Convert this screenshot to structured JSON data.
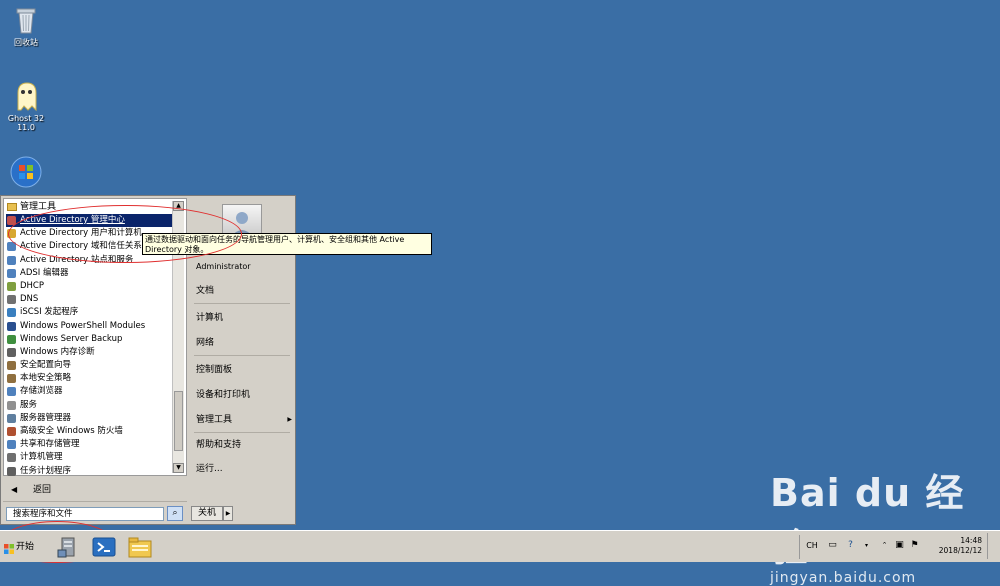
{
  "desktop": {
    "icons": [
      {
        "label": "回收站",
        "icon": "recycle-bin-icon"
      },
      {
        "label": "Ghost 32 11.0",
        "icon": "ghost-icon"
      },
      {
        "label": "",
        "icon": "windows-orb-icon"
      }
    ]
  },
  "start_menu": {
    "folder_label": "管理工具",
    "programs": [
      {
        "label": "Active Directory 管理中心",
        "selected": true,
        "color": "#c0504d"
      },
      {
        "label": "Active Directory 用户和计算机",
        "selected": false,
        "color": "#d8a830"
      },
      {
        "label": "Active Directory 域和信任关系",
        "selected": false,
        "color": "#4f81bd"
      },
      {
        "label": "Active Directory 站点和服务",
        "selected": false,
        "color": "#4f81bd"
      },
      {
        "label": "ADSI 编辑器",
        "selected": false,
        "color": "#4f81bd"
      },
      {
        "label": "DHCP",
        "selected": false,
        "color": "#7f9f3f"
      },
      {
        "label": "DNS",
        "selected": false,
        "color": "#707070"
      },
      {
        "label": "iSCSI 发起程序",
        "selected": false,
        "color": "#3a7fbf"
      },
      {
        "label": "Windows PowerShell Modules",
        "selected": false,
        "color": "#2a4f8f"
      },
      {
        "label": "Windows Server Backup",
        "selected": false,
        "color": "#3f8f3f"
      },
      {
        "label": "Windows 内存诊断",
        "selected": false,
        "color": "#606060"
      },
      {
        "label": "安全配置向导",
        "selected": false,
        "color": "#8f6f3f"
      },
      {
        "label": "本地安全策略",
        "selected": false,
        "color": "#8f6f3f"
      },
      {
        "label": "存储浏览器",
        "selected": false,
        "color": "#4f81bd"
      },
      {
        "label": "服务",
        "selected": false,
        "color": "#909090"
      },
      {
        "label": "服务器管理器",
        "selected": false,
        "color": "#5f7f9f"
      },
      {
        "label": "高级安全 Windows 防火墙",
        "selected": false,
        "color": "#b05030"
      },
      {
        "label": "共享和存储管理",
        "selected": false,
        "color": "#4f81bd"
      },
      {
        "label": "计算机管理",
        "selected": false,
        "color": "#6f6f6f"
      },
      {
        "label": "任务计划程序",
        "selected": false,
        "color": "#606060"
      }
    ],
    "back_label": "返回",
    "search_placeholder": "搜索程序和文件",
    "right_items": [
      {
        "label": "Administrator"
      },
      {
        "label": "文档"
      },
      {
        "label": "计算机"
      },
      {
        "label": "网络"
      },
      {
        "label": "控制面板"
      },
      {
        "label": "设备和打印机"
      },
      {
        "label": "管理工具",
        "arrow": "▶"
      },
      {
        "label": "帮助和支持"
      },
      {
        "label": "运行..."
      }
    ],
    "shutdown_label": "关机",
    "shutdown_arrow": "▶"
  },
  "tooltip": {
    "text": "通过数据驱动和面向任务的导航管理用户、计算机、安全组和其他 Active Directory 对象。"
  },
  "taskbar": {
    "start_label": "开始",
    "apps": [
      "server-manager-icon",
      "powershell-icon",
      "explorer-folder-icon"
    ],
    "tray": {
      "lang": "CH",
      "clock_time": "14:48",
      "clock_date": "2018/12/12"
    }
  },
  "watermark": {
    "logo": "Bai du 经验",
    "url": "jingyan.baidu.com"
  },
  "colors": {
    "desktop": "#3a6ea5",
    "selection": "#0a246a",
    "annotation": "#e03030"
  }
}
